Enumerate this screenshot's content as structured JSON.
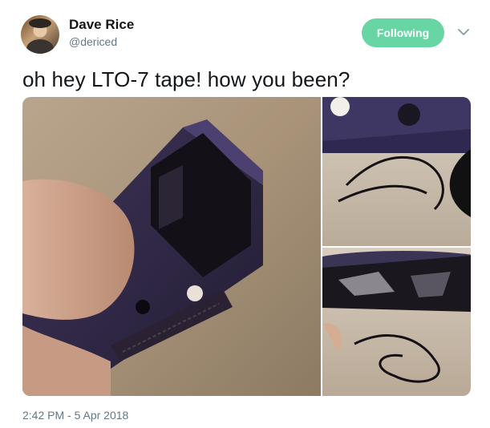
{
  "author": {
    "name": "Dave Rice",
    "handle": "@dericed",
    "avatar_icon": "user-avatar"
  },
  "actions": {
    "follow_label": "Following",
    "follow_color": "#67d6a4",
    "menu_icon": "chevron-down-icon"
  },
  "tweet": {
    "text": "oh hey LTO-7 tape! how you been?"
  },
  "media": {
    "count": 3,
    "items": [
      "photo",
      "photo",
      "photo"
    ]
  },
  "meta": {
    "timestamp": "2:42 PM - 5 Apr 2018"
  }
}
